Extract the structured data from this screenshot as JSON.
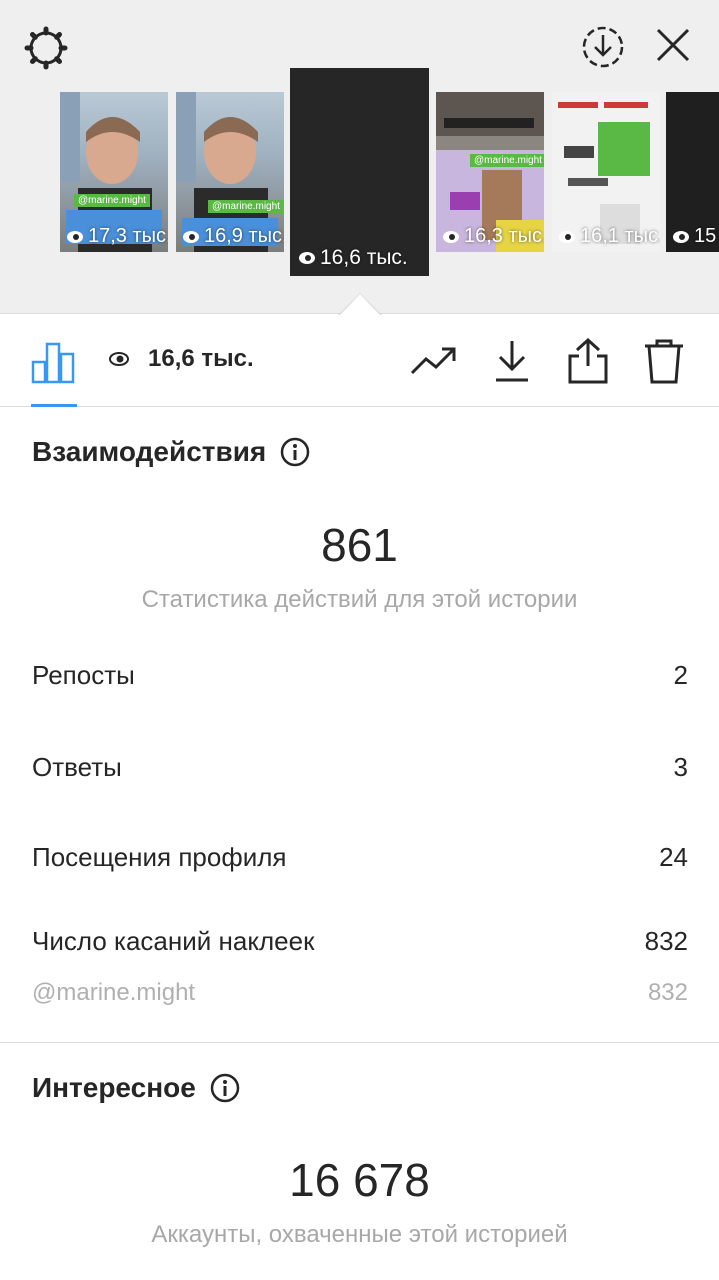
{
  "stories": [
    {
      "views": "17,3 тыс.",
      "sticker": "@marine.might"
    },
    {
      "views": "16,9 тыс.",
      "sticker": "@marine.might"
    },
    {
      "views": "16,6 тыс."
    },
    {
      "views": "16,3 тыс.",
      "sticker": "@marine.might"
    },
    {
      "views": "16,1 тыс."
    },
    {
      "views": "15"
    }
  ],
  "toolbar": {
    "views": "16,6 тыс."
  },
  "interactions": {
    "title": "Взаимодействия",
    "total": "861",
    "subtitle": "Статистика действий для этой истории",
    "rows": [
      {
        "label": "Репосты",
        "value": "2"
      },
      {
        "label": "Ответы",
        "value": "3"
      },
      {
        "label": "Посещения профиля",
        "value": "24"
      },
      {
        "label": "Число касаний наклеек",
        "value": "832"
      }
    ],
    "sticker_row": {
      "label": "@marine.might",
      "value": "832"
    }
  },
  "discovery": {
    "title": "Интересное",
    "total": "16 678",
    "subtitle": "Аккаунты, охваченные этой историей"
  },
  "colors": {
    "accent": "#3897f0",
    "muted": "#a8a8a8",
    "text": "#262626"
  }
}
